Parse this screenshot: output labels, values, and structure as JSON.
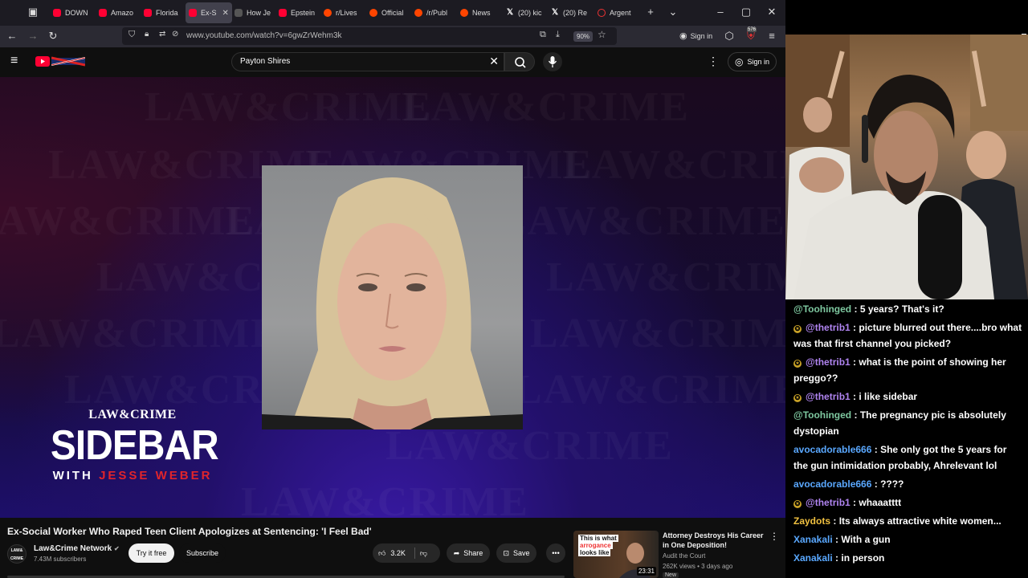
{
  "browser": {
    "tabs": [
      {
        "label": "DOWN",
        "icon": "youtube-icon"
      },
      {
        "label": "Amazo",
        "icon": "youtube-icon"
      },
      {
        "label": "Florida",
        "icon": "youtube-icon"
      },
      {
        "label": "Ex-S",
        "icon": "youtube-icon",
        "active": true
      },
      {
        "label": "How Je",
        "icon": "generic-icon"
      },
      {
        "label": "Epstein",
        "icon": "youtube-icon"
      },
      {
        "label": "r/Lives",
        "icon": "reddit-icon"
      },
      {
        "label": "Official",
        "icon": "reddit-icon"
      },
      {
        "label": "/r/Publ",
        "icon": "reddit-icon"
      },
      {
        "label": "News",
        "icon": "reddit-icon"
      },
      {
        "label": "(20) kic",
        "icon": "x-icon"
      },
      {
        "label": "(20) Re",
        "icon": "x-icon"
      },
      {
        "label": "Argent",
        "icon": "generic-icon"
      }
    ],
    "url": "www.youtube.com/watch?v=6gwZrWehm3k",
    "zoom": "90%",
    "signin_label": "Sign in",
    "extension_badge": "576"
  },
  "youtube": {
    "search_value": "Payton Shires",
    "signin_label": "Sign in",
    "video": {
      "overlay_brand_top": "LAW&CRIME",
      "overlay_title": "SIDEBAR",
      "overlay_with": "WITH",
      "overlay_host": "JESSE WEBER",
      "watermark": "LAW&CRIME"
    },
    "title": "Ex-Social Worker Who Raped Teen Client Apologizes at Sentencing: 'I Feel Bad'",
    "channel": {
      "name": "Law&Crime Network",
      "subscribers": "7.43M subscribers",
      "avatar_text": "LAW& CRIME"
    },
    "actions": {
      "try_free": "Try it free",
      "subscribe": "Subscribe",
      "likes": "3.2K",
      "share": "Share",
      "save": "Save"
    },
    "recommended": {
      "thumb_line1": "This is what",
      "thumb_line2": "arrogance",
      "thumb_line3": "looks like",
      "duration": "23:31",
      "title": "Attorney Destroys His Career in One Deposition!",
      "channel": "Audit the Court",
      "meta": "262K views • 3 days ago",
      "badge": "New"
    }
  },
  "chat": {
    "messages": [
      {
        "user": "@Toohinged",
        "color": "#7ec8a0",
        "text": "5 years? That's it?",
        "badge": false
      },
      {
        "user": "@thetrib1",
        "color": "#b084f0",
        "text": "picture blurred out there....bro what was that first channel you picked?",
        "badge": true
      },
      {
        "user": "@thetrib1",
        "color": "#b084f0",
        "text": "what is the point of showing her preggo??",
        "badge": true
      },
      {
        "user": "@thetrib1",
        "color": "#b084f0",
        "text": "i like sidebar",
        "badge": true
      },
      {
        "user": "@Toohinged",
        "color": "#7ec8a0",
        "text": "The pregnancy pic is absolutely dystopian",
        "badge": false
      },
      {
        "user": "avocadorable666",
        "color": "#5aa8ff",
        "text": "She only got the 5 years for the gun intimidation probably, Ahrelevant lol",
        "badge": false
      },
      {
        "user": "avocadorable666",
        "color": "#5aa8ff",
        "text": "????",
        "badge": false
      },
      {
        "user": "@thetrib1",
        "color": "#b084f0",
        "text": "whaaatttt",
        "badge": true
      },
      {
        "user": "Zaydots",
        "color": "#f0c040",
        "text": "Its always attractive white women...",
        "badge": false
      },
      {
        "user": "Xanakali",
        "color": "#5aa8ff",
        "text": "With a gun",
        "badge": false
      },
      {
        "user": "Xanakali",
        "color": "#5aa8ff",
        "text": "in person",
        "badge": false
      }
    ]
  }
}
